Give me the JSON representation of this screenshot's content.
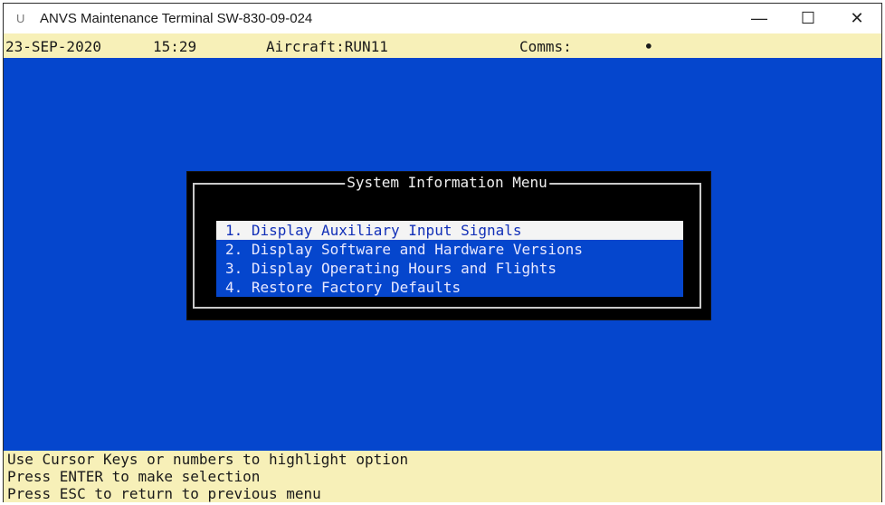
{
  "window": {
    "title": "ANVS Maintenance Terminal SW-830-09-024",
    "app_icon": "U",
    "minimize_glyph": "—",
    "maximize_glyph": "☐",
    "close_glyph": "✕"
  },
  "status": {
    "date": "23-SEP-2020",
    "time": "15:29",
    "aircraft_label": "Aircraft:RUN11",
    "comms_label": "Comms:",
    "comms_indicator": "•"
  },
  "menu": {
    "title": "System Information Menu",
    "selected_index": 0,
    "items": [
      {
        "label": "1. Display Auxiliary Input Signals"
      },
      {
        "label": "2. Display Software and Hardware Versions"
      },
      {
        "label": "3. Display Operating Hours and Flights"
      },
      {
        "label": "4. Restore Factory Defaults"
      }
    ]
  },
  "help": [
    "Use Cursor Keys or numbers to highlight option",
    "Press ENTER to make selection",
    "Press ESC to return to previous menu"
  ],
  "colors": {
    "terminal_bg": "#0546cd",
    "status_bg": "#f7f0b8",
    "highlight_bg": "#f4f4f4"
  }
}
